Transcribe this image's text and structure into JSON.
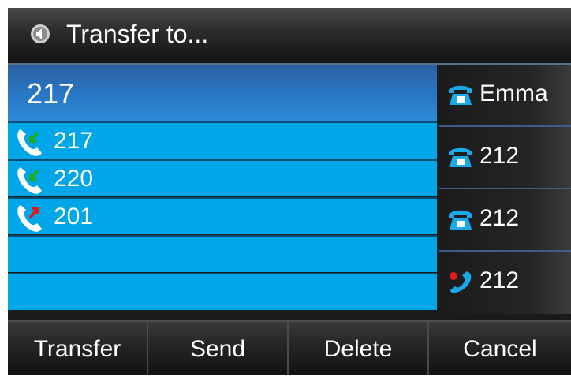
{
  "title": {
    "text": "Transfer to...",
    "icon": "speaker-icon"
  },
  "input": {
    "value": "217"
  },
  "call_list": [
    {
      "number": "217",
      "icon": "received-call-icon",
      "icon_color": "#22aa22"
    },
    {
      "number": "220",
      "icon": "received-call-icon",
      "icon_color": "#22aa22"
    },
    {
      "number": "201",
      "icon": "missed-call-icon",
      "icon_color": "#e01b1b"
    },
    {
      "number": ""
    },
    {
      "number": ""
    }
  ],
  "line_keys": [
    {
      "label": "Emma",
      "icon": "phone-icon"
    },
    {
      "label": "212",
      "icon": "phone-icon"
    },
    {
      "label": "212",
      "icon": "phone-icon"
    },
    {
      "label": "212",
      "icon": "busy-handset-icon"
    }
  ],
  "softkeys": [
    {
      "label": "Transfer"
    },
    {
      "label": "Send"
    },
    {
      "label": "Delete"
    },
    {
      "label": "Cancel"
    }
  ],
  "colors": {
    "row_blue": "#00a6e8",
    "input_blue": "#2877c6",
    "phone_blue": "#19a8e8"
  }
}
